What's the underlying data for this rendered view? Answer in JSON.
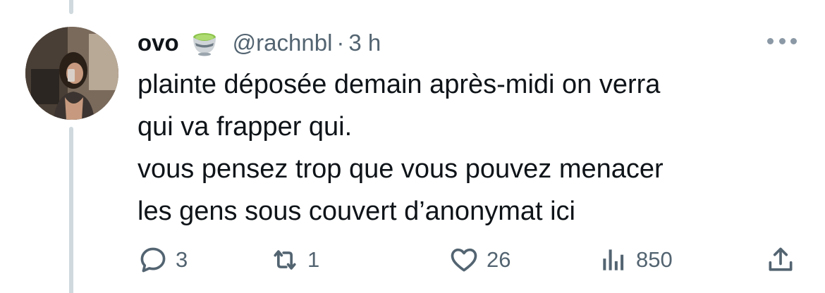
{
  "author": {
    "display_name": "ovo",
    "emoji": "teacup-icon",
    "handle": "@rachnbl",
    "separator": "·",
    "time": "3 h"
  },
  "tweet": {
    "lines": [
      "plainte déposée demain après-midi on verra",
      "qui va frapper qui.",
      "vous pensez trop que vous pouvez menacer",
      "les gens sous couvert d’anonymat ici"
    ]
  },
  "actions": {
    "reply_count": "3",
    "retweet_count": "1",
    "like_count": "26",
    "views_count": "850"
  },
  "colors": {
    "text": "#0f1419",
    "secondary": "#536471",
    "thread_line": "#cfd9de",
    "icon": "#536471"
  }
}
